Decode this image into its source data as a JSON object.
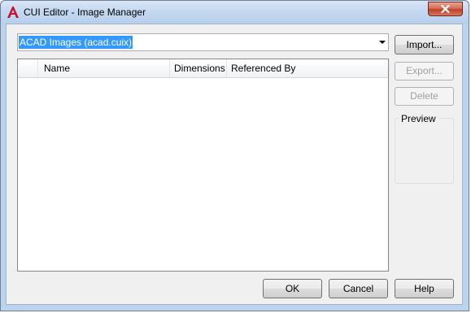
{
  "window": {
    "title": "CUI Editor - Image Manager",
    "close_label": "close"
  },
  "source": {
    "selected": "ACAD Images (acad.cuix)"
  },
  "table": {
    "columns": [
      "",
      "Name",
      "Dimensions",
      "Referenced By",
      ""
    ],
    "rows": []
  },
  "actions": {
    "import": "Import...",
    "export": "Export...",
    "delete": "Delete"
  },
  "preview": {
    "label": "Preview"
  },
  "footer": {
    "ok": "OK",
    "cancel": "Cancel",
    "help": "Help"
  },
  "colors": {
    "brand": "#c8102e",
    "selection": "#3399ff",
    "close": "#c0402a"
  },
  "icons": {
    "app": "autocad-logo-icon",
    "close": "close-icon",
    "dropdown": "chevron-down-icon"
  }
}
